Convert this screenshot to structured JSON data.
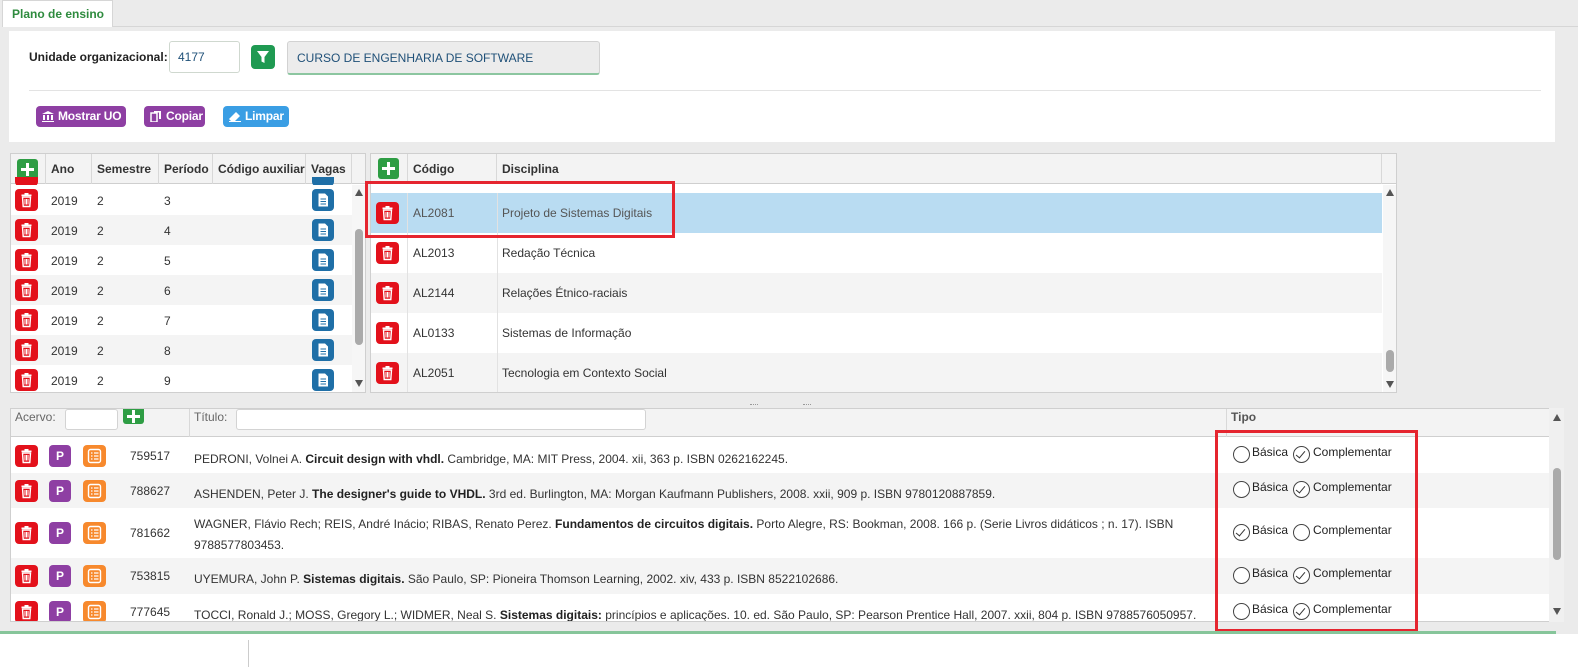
{
  "tab": {
    "label": "Plano de ensino"
  },
  "filters": {
    "unidade_label": "Unidade organizacional:",
    "unidade_value": "4177",
    "course_name": "CURSO DE ENGENHARIA DE SOFTWARE"
  },
  "toolbar": {
    "mostrar_uo": "Mostrar UO",
    "copiar": "Copiar",
    "limpar": "Limpar"
  },
  "periods": {
    "headers": [
      "Ano",
      "Semestre",
      "Período",
      "Código auxiliar",
      "Vagas"
    ],
    "rows": [
      {
        "ano": "2019",
        "semestre": "2",
        "periodo": "3"
      },
      {
        "ano": "2019",
        "semestre": "2",
        "periodo": "4"
      },
      {
        "ano": "2019",
        "semestre": "2",
        "periodo": "5"
      },
      {
        "ano": "2019",
        "semestre": "2",
        "periodo": "6"
      },
      {
        "ano": "2019",
        "semestre": "2",
        "periodo": "7"
      },
      {
        "ano": "2019",
        "semestre": "2",
        "periodo": "8"
      },
      {
        "ano": "2019",
        "semestre": "2",
        "periodo": "9"
      }
    ]
  },
  "disciplines": {
    "headers": [
      "Código",
      "Disciplina"
    ],
    "rows": [
      {
        "codigo": "AL2081",
        "disciplina": "Projeto de Sistemas Digitais",
        "selected": true
      },
      {
        "codigo": "AL2013",
        "disciplina": "Redação Técnica"
      },
      {
        "codigo": "AL2144",
        "disciplina": "Relações Étnico-raciais"
      },
      {
        "codigo": "AL0133",
        "disciplina": "Sistemas de Informação"
      },
      {
        "codigo": "AL2051",
        "disciplina": "Tecnologia em Contexto Social"
      }
    ]
  },
  "bibliography": {
    "acervo_label": "Acervo:",
    "titulo_label": "Título:",
    "tipo_label": "Tipo",
    "basica_label": "Básica",
    "complementar_label": "Complementar",
    "rows": [
      {
        "acervo": "759517",
        "pre": "PEDRONI, Volnei A. ",
        "title": "Circuit design with vhdl.",
        "post": " Cambridge, MA: MIT Press, 2004. xii, 363 p. ISBN 0262162245.",
        "line2": "",
        "tipo": "Complementar"
      },
      {
        "acervo": "788627",
        "pre": "ASHENDEN, Peter J. ",
        "title": "The designer's guide to VHDL.",
        "post": " 3rd ed. Burlington, MA: Morgan Kaufmann Publishers, 2008. xxii, 909 p. ISBN 9780120887859.",
        "line2": "",
        "tipo": "Complementar"
      },
      {
        "acervo": "781662",
        "pre": "WAGNER, Flávio Rech; REIS, André Inácio; RIBAS, Renato Perez. ",
        "title": "Fundamentos de circuitos digitais.",
        "post": " Porto Alegre, RS: Bookman, 2008. 166 p. (Serie Livros didáticos ; n. 17). ISBN",
        "line2": "9788577803453.",
        "tipo": "Básica"
      },
      {
        "acervo": "753815",
        "pre": "UYEMURA, John P. ",
        "title": "Sistemas digitais.",
        "post": " São Paulo, SP: Pioneira Thomson Learning, 2002. xiv, 433 p. ISBN 8522102686.",
        "line2": "",
        "tipo": "Complementar"
      },
      {
        "acervo": "777645",
        "pre": "TOCCI, Ronald J.; MOSS, Gregory L.; WIDMER, Neal S. ",
        "title": "Sistemas digitais:",
        "post": " princípios e aplicações. 10. ed. São Paulo, SP: Pearson Prentice Hall, 2007. xxii, 804 p. ISBN 9788576050957.",
        "line2": "",
        "tipo": "Complementar"
      }
    ]
  },
  "colors": {
    "accent_green": "#2e9d44",
    "delete_red": "#e3111b",
    "highlight_box": "#e5252f",
    "selected_row": "#b9dcf2"
  }
}
